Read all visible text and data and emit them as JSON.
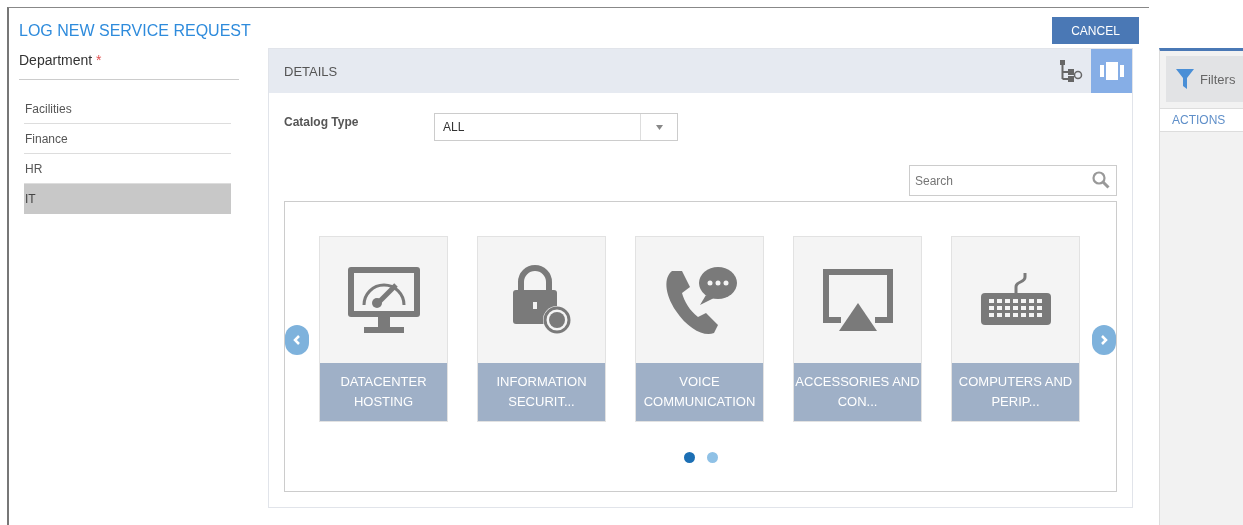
{
  "dialog": {
    "title": "LOG NEW SERVICE REQUEST",
    "cancel_button": "CANCEL"
  },
  "department": {
    "label": "Department",
    "required_mark": "*",
    "items": [
      {
        "label": "Facilities",
        "selected": false
      },
      {
        "label": "Finance",
        "selected": false
      },
      {
        "label": "HR",
        "selected": false
      },
      {
        "label": "IT",
        "selected": true
      }
    ]
  },
  "details": {
    "title": "DETAILS",
    "views": [
      {
        "kind": "tree",
        "selected": false
      },
      {
        "kind": "carousel",
        "selected": true
      }
    ],
    "catalog_type": {
      "label": "Catalog Type",
      "value": "ALL"
    },
    "search": {
      "placeholder": "Search"
    },
    "cards": [
      {
        "kind": "monitor",
        "label": "DATACENTER HOSTING"
      },
      {
        "kind": "lock",
        "label": "INFORMATION SECURIT..."
      },
      {
        "kind": "phone",
        "label": "VOICE COMMUNICATION"
      },
      {
        "kind": "cast",
        "label": "ACCESSORIES AND CON..."
      },
      {
        "kind": "keyboard",
        "label": "COMPUTERS AND PERIP..."
      }
    ],
    "pages": [
      {
        "selected": true
      },
      {
        "selected": false
      }
    ]
  },
  "side_panel": {
    "filters_button": "Filters",
    "actions_label": "ACTIONS"
  }
}
